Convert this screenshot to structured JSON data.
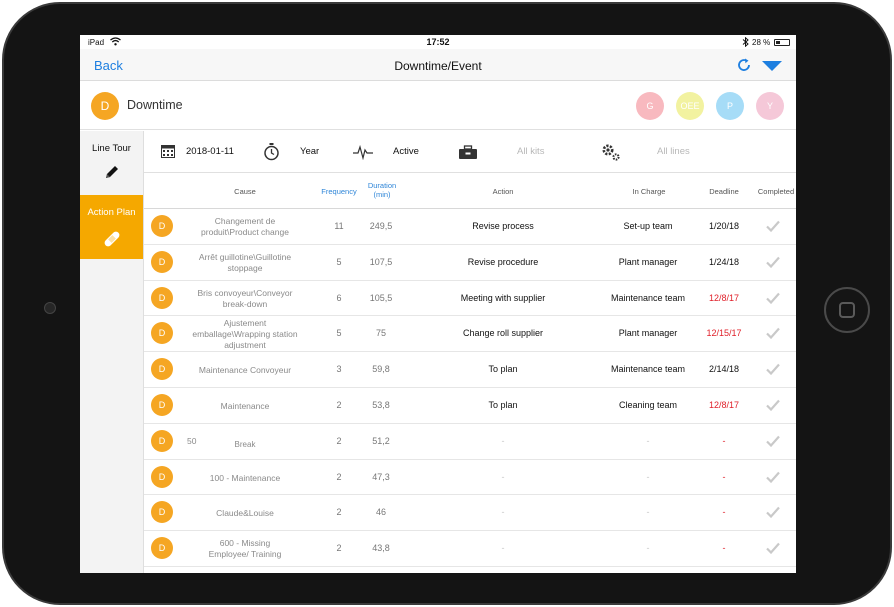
{
  "status_bar": {
    "carrier": "iPad",
    "time": "17:52",
    "battery": "28 %"
  },
  "nav": {
    "back": "Back",
    "title": "Downtime/Event"
  },
  "header": {
    "avatar": "D",
    "title": "Downtime"
  },
  "filter_circles": [
    {
      "label": "G",
      "color": "#f8b9bf"
    },
    {
      "label": "OEE",
      "color": "#f2f2a0"
    },
    {
      "label": "P",
      "color": "#a6dcf7"
    },
    {
      "label": "Y",
      "color": "#f5c8d8"
    }
  ],
  "sidebar": {
    "line_tour": "Line Tour",
    "action_plan": "Action Plan"
  },
  "toolbar": {
    "date": "2018-01-11",
    "period": "Year",
    "status": "Active",
    "kits": "All kits",
    "lines": "All lines"
  },
  "columns": {
    "cause": "Cause",
    "frequency": "Frequency",
    "duration": "Duration\n(min)",
    "action": "Action",
    "in_charge": "In Charge",
    "deadline": "Deadline",
    "completed": "Completed"
  },
  "rows": [
    {
      "avatar": "D",
      "cause": "Changement de\nproduit\\Product change",
      "frequency": "11",
      "duration": "249,5",
      "action": "Revise process",
      "in_charge": "Set-up team",
      "deadline": "1/20/18",
      "overdue": false
    },
    {
      "avatar": "D",
      "cause": "Arrêt guillotine\\Guillotine\nstoppage",
      "frequency": "5",
      "duration": "107,5",
      "action": "Revise procedure",
      "in_charge": "Plant manager",
      "deadline": "1/24/18",
      "overdue": false
    },
    {
      "avatar": "D",
      "cause": "Bris convoyeur\\Conveyor\nbreak-down",
      "frequency": "6",
      "duration": "105,5",
      "action": "Meeting with supplier",
      "in_charge": "Maintenance team",
      "deadline": "12/8/17",
      "overdue": true
    },
    {
      "avatar": "D",
      "cause": "Ajustement\nemballage\\Wrapping station\nadjustment",
      "frequency": "5",
      "duration": "75",
      "action": "Change roll supplier",
      "in_charge": "Plant manager",
      "deadline": "12/15/17",
      "overdue": true
    },
    {
      "avatar": "D",
      "cause": "Maintenance Convoyeur",
      "frequency": "3",
      "duration": "59,8",
      "action": "To plan",
      "in_charge": "Maintenance team",
      "deadline": "2/14/18",
      "overdue": false
    },
    {
      "avatar": "D",
      "cause": "Maintenance",
      "frequency": "2",
      "duration": "53,8",
      "action": "To plan",
      "in_charge": "Cleaning team",
      "deadline": "12/8/17",
      "overdue": true
    },
    {
      "avatar": "D",
      "cause_prefix": "50",
      "cause": "Break",
      "frequency": "2",
      "duration": "51,2",
      "action": "-",
      "in_charge": "-",
      "deadline": "-",
      "overdue": true
    },
    {
      "avatar": "D",
      "cause": "100 - Maintenance",
      "frequency": "2",
      "duration": "47,3",
      "action": "-",
      "in_charge": "-",
      "deadline": "-",
      "overdue": true
    },
    {
      "avatar": "D",
      "cause": "Claude&Louise",
      "frequency": "2",
      "duration": "46",
      "action": "-",
      "in_charge": "-",
      "deadline": "-",
      "overdue": true
    },
    {
      "avatar": "D",
      "cause": "600 - Missing\nEmployee/ Training",
      "frequency": "2",
      "duration": "43,8",
      "action": "-",
      "in_charge": "-",
      "deadline": "-",
      "overdue": true
    }
  ],
  "colors": {
    "accent": "#1e7fe0",
    "avatar": "#f5a623",
    "sidebar_active": "#f5a800",
    "overdue": "#e0202a",
    "frequency_header": "#2f86d8"
  }
}
